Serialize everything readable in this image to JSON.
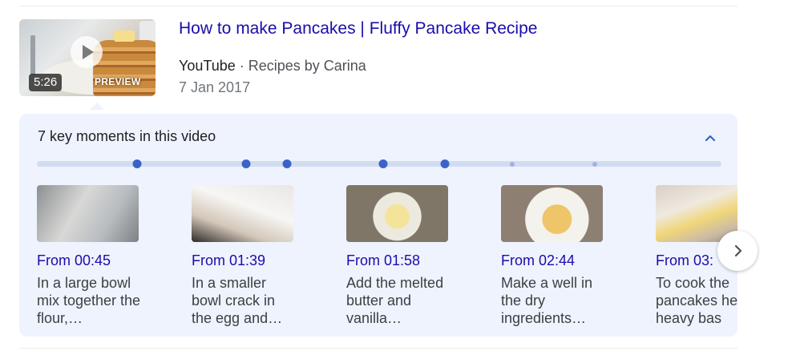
{
  "result": {
    "title": "How to make Pancakes | Fluffy Pancake Recipe",
    "site": "YouTube",
    "separator": " · ",
    "channel": "Recipes by Carina",
    "date": "7 Jan 2017",
    "duration": "5:26",
    "preview_label": "PREVIEW"
  },
  "key_moments": {
    "heading": "7 key moments in this video",
    "collapse_icon": "chevron-up-icon",
    "timeline_ticks": [
      {
        "type": "major"
      },
      {
        "type": "major"
      },
      {
        "type": "major"
      },
      {
        "type": "major"
      },
      {
        "type": "major"
      },
      {
        "type": "minor"
      },
      {
        "type": "minor"
      }
    ],
    "items": [
      {
        "from": "From 00:45",
        "desc": "In a large bowl mix together the flour,…"
      },
      {
        "from": "From 01:39",
        "desc": "In a smaller bowl crack in the egg and…"
      },
      {
        "from": "From 01:58",
        "desc": "Add the melted butter and vanilla…"
      },
      {
        "from": "From 02:44",
        "desc": "Make a well in the dry ingredients…"
      },
      {
        "from": "From 03:",
        "desc": "To cook the pancakes he a heavy bas"
      }
    ],
    "next_icon": "chevron-right-icon"
  },
  "colors": {
    "link": "#1a0dab",
    "panel_bg": "#eef3fd",
    "timeline_major": "#3b63c7"
  }
}
